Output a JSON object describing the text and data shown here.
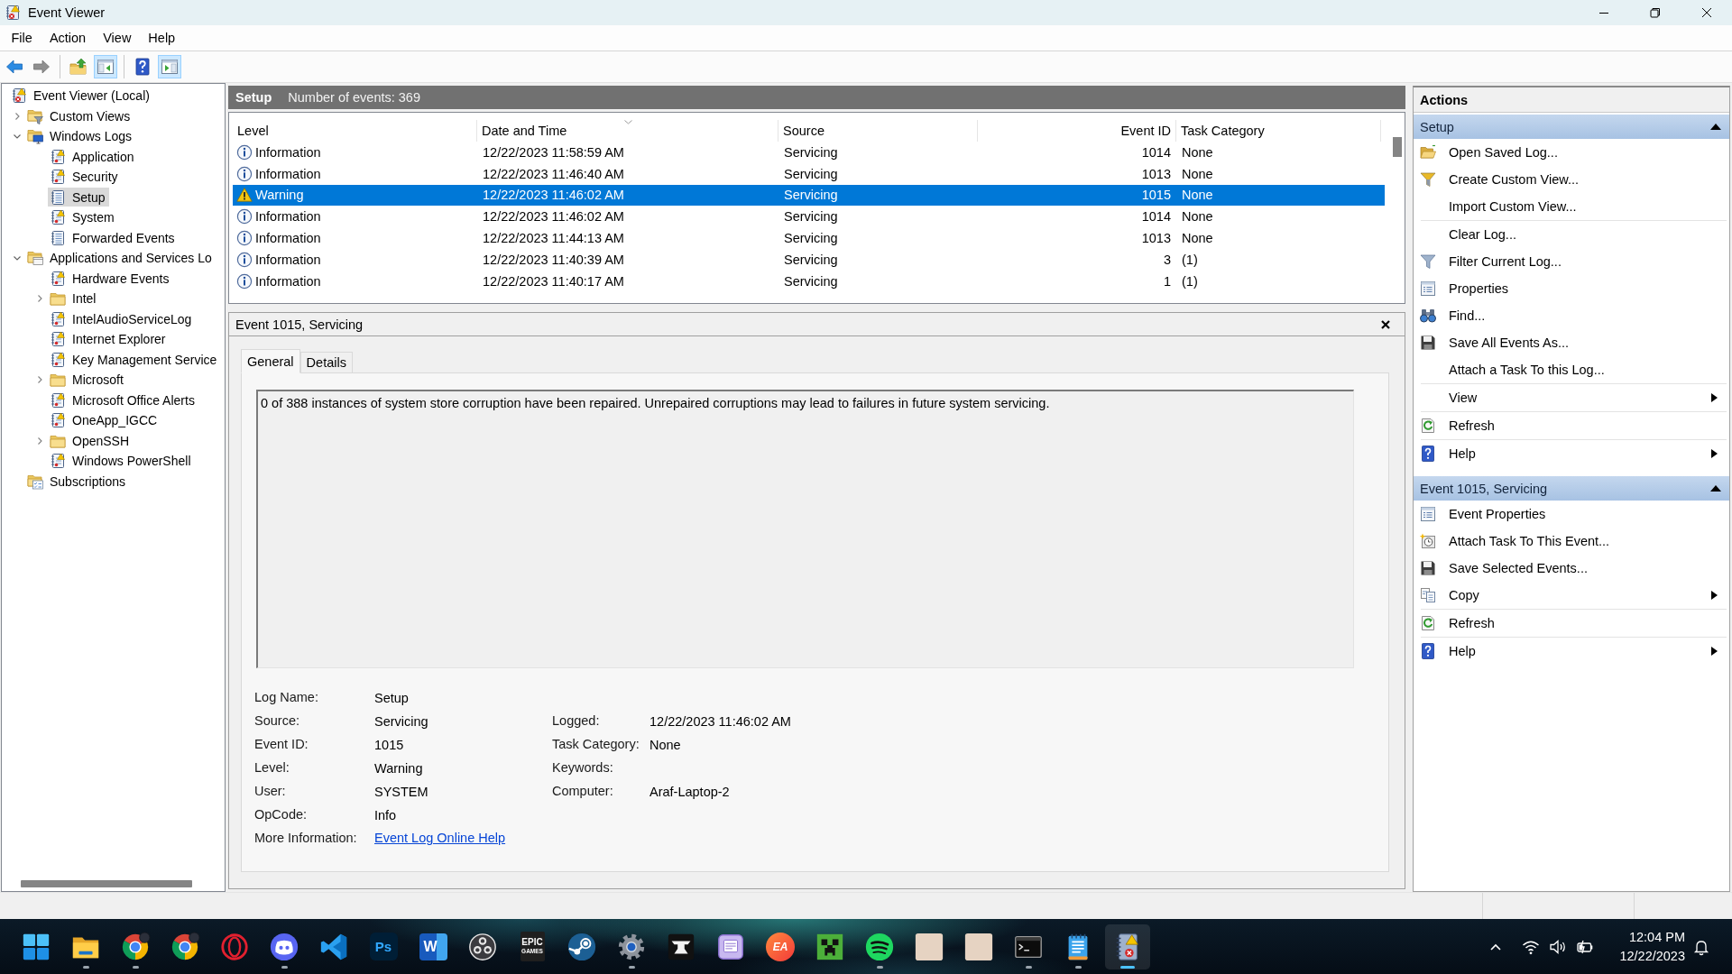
{
  "window": {
    "title": "Event Viewer"
  },
  "menu": [
    "File",
    "Action",
    "View",
    "Help"
  ],
  "toolbar": [
    [
      {
        "kind": "back",
        "disabled": false,
        "pressed": false
      },
      {
        "kind": "forward",
        "disabled": true,
        "pressed": false
      }
    ],
    [
      {
        "kind": "up",
        "disabled": false,
        "pressed": false
      },
      {
        "kind": "tree-toggle",
        "disabled": false,
        "pressed": true
      }
    ],
    [
      {
        "kind": "help",
        "disabled": false,
        "pressed": false
      },
      {
        "kind": "pane-toggle",
        "disabled": false,
        "pressed": true
      }
    ]
  ],
  "tree": [
    {
      "label": "Event Viewer (Local)",
      "kind": "root",
      "selected": false,
      "children": [
        {
          "label": "Custom Views",
          "kind": "filter-folder",
          "expanded": false,
          "selected": false
        },
        {
          "label": "Windows Logs",
          "kind": "computer-folder",
          "expanded": true,
          "selected": false,
          "children": [
            {
              "label": "Application",
              "kind": "log",
              "selected": false
            },
            {
              "label": "Security",
              "kind": "log",
              "selected": false
            },
            {
              "label": "Setup",
              "kind": "plain-log",
              "selected": true
            },
            {
              "label": "System",
              "kind": "log",
              "selected": false
            },
            {
              "label": "Forwarded Events",
              "kind": "plain-log",
              "selected": false
            }
          ]
        },
        {
          "label": "Applications and Services Lo",
          "kind": "window-folder",
          "expanded": true,
          "selected": false,
          "children": [
            {
              "label": "Hardware Events",
              "kind": "log",
              "selected": false
            },
            {
              "label": "Intel",
              "kind": "folder",
              "expanded": false,
              "selected": false
            },
            {
              "label": "IntelAudioServiceLog",
              "kind": "log",
              "selected": false
            },
            {
              "label": "Internet Explorer",
              "kind": "log",
              "selected": false
            },
            {
              "label": "Key Management Service",
              "kind": "log",
              "selected": false
            },
            {
              "label": "Microsoft",
              "kind": "folder",
              "expanded": false,
              "selected": false
            },
            {
              "label": "Microsoft Office Alerts",
              "kind": "log",
              "selected": false
            },
            {
              "label": "OneApp_IGCC",
              "kind": "log",
              "selected": false
            },
            {
              "label": "OpenSSH",
              "kind": "folder",
              "expanded": false,
              "selected": false
            },
            {
              "label": "Windows PowerShell",
              "kind": "log",
              "selected": false
            }
          ]
        },
        {
          "label": "Subscriptions",
          "kind": "subscriptions",
          "selected": false
        }
      ]
    }
  ],
  "log_header": {
    "title": "Setup",
    "count": "Number of events: 369"
  },
  "events": {
    "columns": [
      {
        "label": "Level",
        "sorted": false
      },
      {
        "label": "Date and Time",
        "sorted": true
      },
      {
        "label": "Source",
        "sorted": false
      },
      {
        "label": "Event ID",
        "sorted": false
      },
      {
        "label": "Task Category",
        "sorted": false
      }
    ],
    "rows": [
      {
        "kind": "information",
        "level": "Information",
        "date": "12/22/2023 11:58:59 AM",
        "source": "Servicing",
        "event_id": "1014",
        "task_category": "None",
        "selected": false
      },
      {
        "kind": "information",
        "level": "Information",
        "date": "12/22/2023 11:46:40 AM",
        "source": "Servicing",
        "event_id": "1013",
        "task_category": "None",
        "selected": false
      },
      {
        "kind": "warning",
        "level": "Warning",
        "date": "12/22/2023 11:46:02 AM",
        "source": "Servicing",
        "event_id": "1015",
        "task_category": "None",
        "selected": true
      },
      {
        "kind": "information",
        "level": "Information",
        "date": "12/22/2023 11:46:02 AM",
        "source": "Servicing",
        "event_id": "1014",
        "task_category": "None",
        "selected": false
      },
      {
        "kind": "information",
        "level": "Information",
        "date": "12/22/2023 11:44:13 AM",
        "source": "Servicing",
        "event_id": "1013",
        "task_category": "None",
        "selected": false
      },
      {
        "kind": "information",
        "level": "Information",
        "date": "12/22/2023 11:40:39 AM",
        "source": "Servicing",
        "event_id": "3",
        "task_category": "(1)",
        "selected": false
      },
      {
        "kind": "information",
        "level": "Information",
        "date": "12/22/2023 11:40:17 AM",
        "source": "Servicing",
        "event_id": "1",
        "task_category": "(1)",
        "selected": false
      }
    ]
  },
  "detail": {
    "title": "Event 1015, Servicing",
    "tabs": [
      {
        "label": "General",
        "selected": true
      },
      {
        "label": "Details",
        "selected": false
      }
    ],
    "description": "0 of 388 instances of system store corruption have been repaired. Unrepaired corruptions may lead to failures in future system servicing.",
    "fields": [
      {
        "label": "Log Name:",
        "value": "Setup"
      },
      {
        "label": "Source:",
        "value": "Servicing"
      },
      {
        "label": "Event ID:",
        "value": "1015"
      },
      {
        "label": "Level:",
        "value": "Warning"
      },
      {
        "label": "User:",
        "value": "SYSTEM"
      },
      {
        "label": "OpCode:",
        "value": "Info"
      },
      {
        "label": "More Information:",
        "link": "Event Log Online Help"
      }
    ],
    "fields_right": [
      {
        "label": "Logged:",
        "value": "12/22/2023 11:46:02 AM"
      },
      {
        "label": "Task Category:",
        "value": "None"
      },
      {
        "label": "Keywords:"
      },
      {
        "label": "Computer:",
        "value": "Araf-Laptop-2"
      }
    ]
  },
  "actions": {
    "title": "Actions",
    "sections": [
      {
        "title": "Setup",
        "expanded": true,
        "groups": [
          [
            {
              "label": "Open Saved Log...",
              "kind": "open",
              "submenu": false
            },
            {
              "label": "Create Custom View...",
              "kind": "create-view",
              "submenu": false
            },
            {
              "label": "Import Custom View...",
              "submenu": false
            }
          ],
          [
            {
              "label": "Clear Log...",
              "submenu": false
            },
            {
              "label": "Filter Current Log...",
              "kind": "filter",
              "submenu": false
            },
            {
              "label": "Properties",
              "kind": "properties",
              "submenu": false
            },
            {
              "label": "Find...",
              "kind": "find",
              "submenu": false
            },
            {
              "label": "Save All Events As...",
              "kind": "save",
              "submenu": false
            },
            {
              "label": "Attach a Task To this Log...",
              "submenu": false
            }
          ],
          [
            {
              "label": "View",
              "submenu": true
            }
          ],
          [
            {
              "label": "Refresh",
              "kind": "refresh",
              "submenu": false
            }
          ],
          [
            {
              "label": "Help",
              "kind": "help",
              "submenu": true
            }
          ]
        ]
      },
      {
        "title": "Event 1015, Servicing",
        "expanded": true,
        "groups": [
          [
            {
              "label": "Event Properties",
              "kind": "properties",
              "submenu": false
            },
            {
              "label": "Attach Task To This Event...",
              "kind": "task",
              "submenu": false
            },
            {
              "label": "Save Selected Events...",
              "kind": "save",
              "submenu": false
            },
            {
              "label": "Copy",
              "kind": "copy",
              "submenu": true
            }
          ],
          [
            {
              "label": "Refresh",
              "kind": "refresh",
              "submenu": false
            }
          ],
          [
            {
              "label": "Help",
              "kind": "help",
              "submenu": true
            }
          ]
        ]
      }
    ]
  },
  "taskbar": {
    "apps": [
      {
        "kind": "start",
        "running": false,
        "selected": false
      },
      {
        "kind": "files",
        "running": true,
        "selected": false
      },
      {
        "kind": "browser",
        "running": true,
        "selected": false
      },
      {
        "kind": "browser",
        "running": false,
        "selected": false
      },
      {
        "kind": "ring",
        "running": false,
        "selected": false
      },
      {
        "kind": "chat",
        "running": true,
        "selected": false
      },
      {
        "kind": "editor",
        "running": false,
        "selected": false
      },
      {
        "kind": "image-editor",
        "text": "Ps",
        "running": false,
        "selected": false
      },
      {
        "kind": "word-processor",
        "text": "W",
        "running": false,
        "selected": false
      },
      {
        "kind": "recorder",
        "running": false,
        "selected": false
      },
      {
        "kind": "game-store",
        "text": "EPIC",
        "subtext": "GAMES",
        "running": false,
        "selected": false
      },
      {
        "kind": "game-client",
        "running": false,
        "selected": false
      },
      {
        "kind": "settings",
        "running": true,
        "selected": false
      },
      {
        "kind": "anvil",
        "running": false,
        "selected": false
      },
      {
        "kind": "square-app",
        "running": false,
        "selected": false
      },
      {
        "kind": "game-app",
        "text": "EA",
        "running": false,
        "selected": false
      },
      {
        "kind": "block-game",
        "running": false,
        "selected": false
      },
      {
        "kind": "music",
        "running": true,
        "selected": false
      },
      {
        "kind": "picture-app",
        "running": false,
        "selected": false
      },
      {
        "kind": "picture-app",
        "running": false,
        "selected": false
      },
      {
        "kind": "terminal",
        "running": true,
        "selected": false
      },
      {
        "kind": "notepad",
        "running": true,
        "selected": false
      },
      {
        "kind": "event-viewer",
        "running": true,
        "selected": true
      }
    ],
    "clock": {
      "time": "12:04 PM",
      "date": "12/22/2023"
    }
  }
}
